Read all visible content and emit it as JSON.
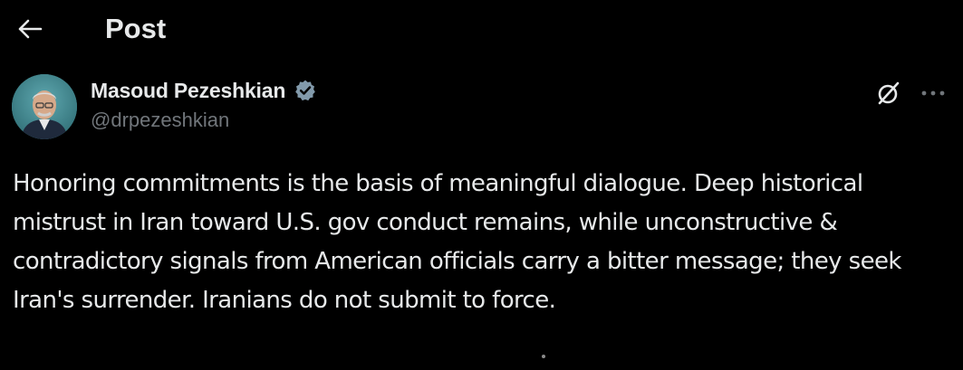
{
  "header": {
    "title": "Post",
    "back_icon": "arrow-left-icon"
  },
  "author": {
    "display_name": "Masoud Pezeshkian",
    "handle": "@drpezeshkian",
    "verified": true,
    "verified_color": "#829aab"
  },
  "actions": {
    "grok_icon": "grok-icon",
    "more_icon": "more-horizontal-icon"
  },
  "post": {
    "text": "Honoring commitments is the basis of meaningful dialogue. Deep historical mistrust in Iran toward U.S. gov conduct remains, while unconstructive & contradictory signals from American officials carry a bitter message; they seek Iran's surrender. Iranians do not submit to force."
  },
  "colors": {
    "background": "#000000",
    "primary_text": "#e7e9ea",
    "secondary_text": "#71767b"
  }
}
